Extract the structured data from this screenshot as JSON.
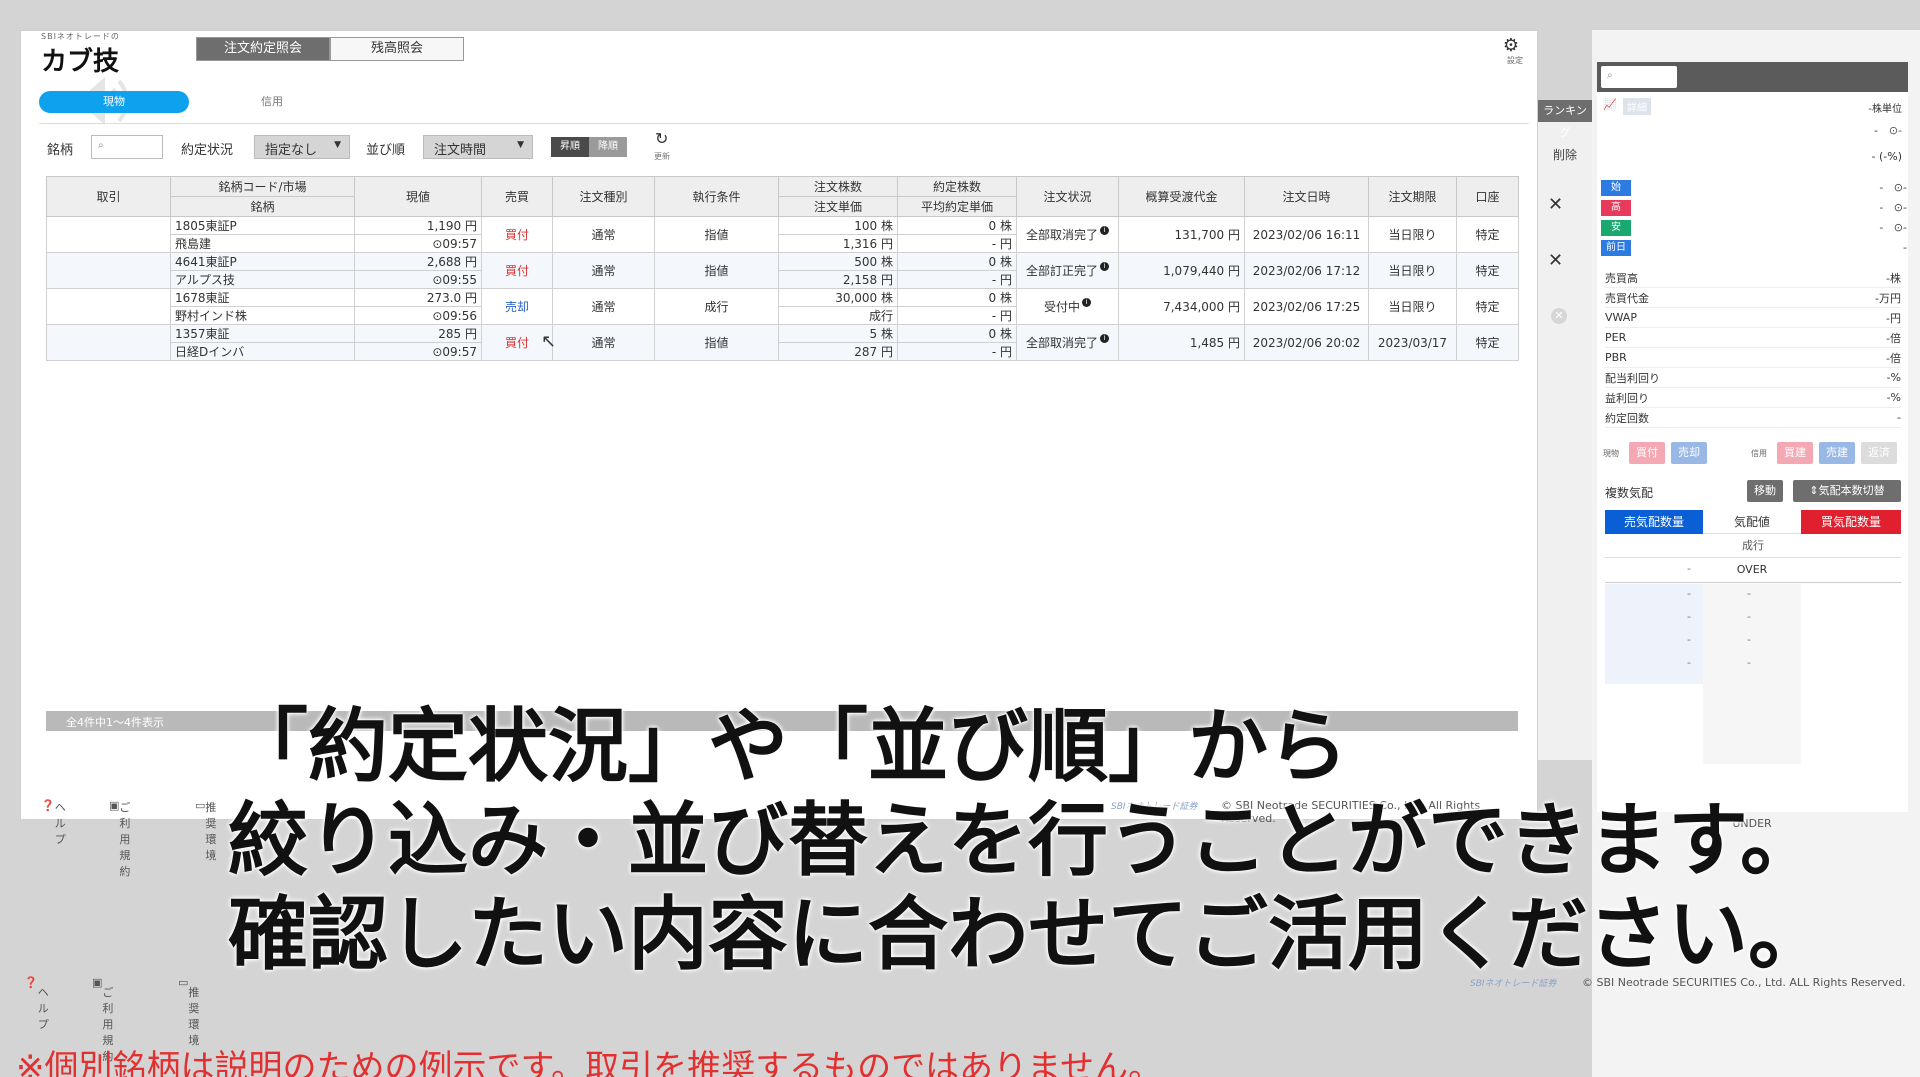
{
  "bg_panel": {
    "gear_label": "設定",
    "search_placeholder": "",
    "unit_label": "-株単位",
    "header_btn1": "詳細",
    "vals_top": [
      "-",
      "- (-%)"
    ],
    "chips": [
      {
        "label": "始",
        "color": "#2d7be0",
        "value": "-"
      },
      {
        "label": "高",
        "color": "#e83a5a",
        "value": "-"
      },
      {
        "label": "安",
        "color": "#1aa870",
        "value": "-"
      },
      {
        "label": "前日",
        "color": "#2d7be0",
        "value": "-"
      }
    ],
    "stats": [
      {
        "label": "売買高",
        "value": "-株"
      },
      {
        "label": "売買代金",
        "value": "-万円"
      },
      {
        "label": "VWAP",
        "value": "-円"
      },
      {
        "label": "PER",
        "value": "-倍"
      },
      {
        "label": "PBR",
        "value": "-倍"
      },
      {
        "label": "配当利回り",
        "value": "-%"
      },
      {
        "label": "益利回り",
        "value": "-%"
      },
      {
        "label": "約定回数",
        "value": "-"
      }
    ],
    "trade_labels": {
      "spot": "現物",
      "margin": "信用",
      "buy": "買付",
      "sell": "売却",
      "mbuy": "買建",
      "msell": "売建",
      "close": "返済"
    },
    "multi_quote": "複数気配",
    "move_btn": "移動",
    "switch_btn": "⇕気配本数切替",
    "col_sell": "売気配数量",
    "col_price": "気配値",
    "col_buy": "買気配数量",
    "market": "成行",
    "over": "OVER",
    "under": "UNDER"
  },
  "side_strip": {
    "ranking": "ランキング",
    "delete": "削除"
  },
  "bg_footer": {
    "help": "ヘルプ",
    "terms": "ご利用規約",
    "env": "推奨環境",
    "brand": "SBIネオトレード証券",
    "copyright": "© SBI Neotrade SECURITIES Co., Ltd. ALL Rights Reserved."
  },
  "main": {
    "logo": "カブ技",
    "logo_sub": "SBIネオトレードの",
    "tabs": {
      "order": "注文約定照会",
      "balance": "残高照会"
    },
    "gear_label": "設定",
    "subtab_active": "現物",
    "subtab_margin": "信用",
    "filters": {
      "symbol_label": "銘柄",
      "symbol_placeholder": "",
      "status_label": "約定状況",
      "status_value": "指定なし",
      "sort_label": "並び順",
      "sort_value": "注文時間",
      "asc": "昇順",
      "desc": "降順",
      "refresh_label": "更新"
    },
    "table": {
      "headers": {
        "trade": "取引",
        "symbol": "銘柄コード/市場",
        "symbol2": "銘柄",
        "price": "現値",
        "side": "売買",
        "type": "注文種別",
        "cond": "執行条件",
        "qty": "注文株数",
        "unit_price": "注文単価",
        "fill_qty": "約定株数",
        "avg_price": "平均約定単価",
        "status": "注文状況",
        "amount": "概算受渡代金",
        "date": "注文日時",
        "expiry": "注文期限",
        "account": "口座"
      },
      "rows": [
        {
          "code": "1805東証P",
          "name": "飛島建",
          "price": "1,190 円",
          "time": "⊙09:57",
          "side": "買付",
          "side_class": "buy",
          "type": "通常",
          "cond": "指値",
          "qty": "100 株",
          "uprice": "1,316 円",
          "fqty": "0 株",
          "aprice": "- 円",
          "status": "全部取消完了",
          "amount": "131,700 円",
          "date": "2023/02/06 16:11",
          "expiry": "当日限り",
          "account": "特定"
        },
        {
          "code": "4641東証P",
          "name": "アルプス技",
          "price": "2,688 円",
          "time": "⊙09:55",
          "side": "買付",
          "side_class": "buy",
          "type": "通常",
          "cond": "指値",
          "qty": "500 株",
          "uprice": "2,158 円",
          "fqty": "0 株",
          "aprice": "- 円",
          "status": "全部訂正完了",
          "amount": "1,079,440 円",
          "date": "2023/02/06 17:12",
          "expiry": "当日限り",
          "account": "特定"
        },
        {
          "code": "1678東証",
          "name": "野村インド株",
          "price": "273.0 円",
          "time": "⊙09:56",
          "side": "売却",
          "side_class": "sell",
          "type": "通常",
          "cond": "成行",
          "qty": "30,000 株",
          "uprice": "成行",
          "fqty": "0 株",
          "aprice": "- 円",
          "status": "受付中",
          "amount": "7,434,000 円",
          "date": "2023/02/06 17:25",
          "expiry": "当日限り",
          "account": "特定"
        },
        {
          "code": "1357東証",
          "name": "日経Dインバ",
          "price": "285 円",
          "time": "⊙09:57",
          "side": "買付",
          "side_class": "buy",
          "type": "通常",
          "cond": "指値",
          "qty": "5 株",
          "uprice": "287 円",
          "fqty": "0 株",
          "aprice": "- 円",
          "status": "全部取消完了",
          "amount": "1,485 円",
          "date": "2023/02/06 20:02",
          "expiry": "2023/03/17",
          "account": "特定"
        }
      ]
    },
    "count_text": "全4件中1～4件表示",
    "footer": {
      "help": "ヘルプ",
      "terms": "ご利用規約",
      "env": "推奨環境",
      "brand": "SBIネオトレード証券",
      "copyright": "© SBI Neotrade SECURITIES Co., Ltd. All Rights Reserved."
    }
  },
  "caption": {
    "line1": "「約定状況」や「並び順」から",
    "line2": "絞り込み・並び替えを行うことができます。",
    "line3": "確認したい内容に合わせてご活用ください。"
  },
  "disclaimer": "※個別銘柄は説明のための例示です。取引を推奨するものではありません。"
}
